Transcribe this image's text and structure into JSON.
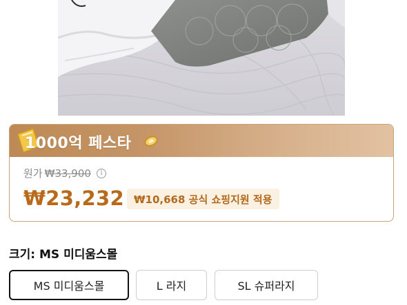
{
  "product_image": {
    "alt": "",
    "icon": "pillow-photo"
  },
  "promo": {
    "title": "1000억 페스타",
    "original_label": "원가",
    "original_price": "₩33,900",
    "info_icon": "i",
    "sale_price": "₩23,232",
    "support_badge": "₩10,668 공식 쇼핑지원 적용",
    "colors": {
      "accent": "#b86a1a",
      "header_start": "#bd8a55",
      "header_end": "#e2c2a2",
      "badge_bg": "#fbf1e2"
    }
  },
  "size": {
    "title": "크기: MS 미디움스몰",
    "options": [
      {
        "label": "MS 미디움스몰",
        "selected": true
      },
      {
        "label": "L 라지",
        "selected": false
      },
      {
        "label": "SL 슈퍼라지",
        "selected": false
      }
    ]
  }
}
